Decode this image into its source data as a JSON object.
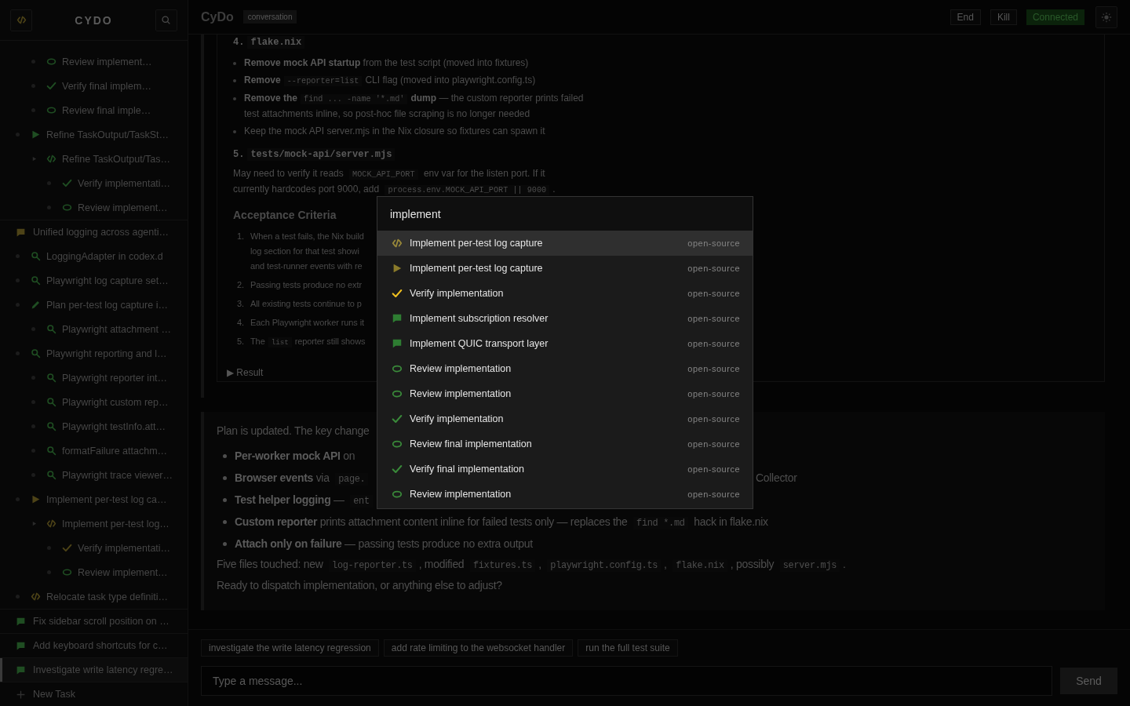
{
  "sidebar": {
    "title": "CYDO",
    "tasks": [
      {
        "children": [
          {
            "children": [
              {
                "label": "Review implement…",
                "kind": "eye",
                "color": "#1f4d22",
                "selected": false
              },
              {
                "label": "Verify final implem…",
                "kind": "check",
                "color": "#1f4d22",
                "selected": false
              },
              {
                "label": "Review final imple…",
                "kind": "eye",
                "color": "#1f4d22",
                "selected": false
              }
            ]
          },
          {
            "label": "Refine TaskOutput/TaskSt…",
            "kind": "play",
            "color": "#1f4d22",
            "selected": false,
            "children": [
              {
                "label": "Refine TaskOutput/Tas…",
                "kind": "code",
                "color": "#1f4d22",
                "selected": false,
                "toggle": true,
                "children": [
                  {
                    "label": "Verify implementati…",
                    "kind": "check",
                    "color": "#1f4d22",
                    "selected": false
                  },
                  {
                    "label": "Review implement…",
                    "kind": "eye",
                    "color": "#1f4d22",
                    "selected": false
                  }
                ]
              }
            ]
          }
        ]
      },
      {
        "label": "Unified logging across agenti…",
        "kind": "chat",
        "color": "#4d4317",
        "selected": false,
        "children": [
          {
            "label": "LoggingAdapter in codex.d",
            "kind": "search",
            "color": "#1f4d22",
            "selected": false
          },
          {
            "label": "Playwright log capture set…",
            "kind": "search",
            "color": "#1f4d22",
            "selected": false
          },
          {
            "label": "Plan per-test log capture i…",
            "kind": "pencil",
            "color": "#1f4d22",
            "selected": false,
            "children": [
              {
                "label": "Playwright attachment …",
                "kind": "search",
                "color": "#1f4d22",
                "selected": false
              }
            ]
          },
          {
            "label": "Playwright reporting and l…",
            "kind": "search",
            "color": "#1f4d22",
            "selected": false,
            "children": [
              {
                "label": "Playwright reporter int…",
                "kind": "search",
                "color": "#1f4d22",
                "selected": false
              },
              {
                "label": "Playwright custom rep…",
                "kind": "search",
                "color": "#1f4d22",
                "selected": false
              },
              {
                "label": "Playwright testInfo.att…",
                "kind": "search",
                "color": "#1f4d22",
                "selected": false
              },
              {
                "label": "formatFailure attachm…",
                "kind": "search",
                "color": "#1f4d22",
                "selected": false
              },
              {
                "label": "Playwright trace viewer…",
                "kind": "search",
                "color": "#1f4d22",
                "selected": false
              }
            ]
          },
          {
            "label": "Implement per-test log ca…",
            "kind": "play",
            "color": "#4d4317",
            "selected": false,
            "children": [
              {
                "label": "Implement per-test log…",
                "kind": "code",
                "color": "#4d4317",
                "selected": false,
                "toggle": true,
                "children": [
                  {
                    "label": "Verify implementati…",
                    "kind": "check",
                    "color": "#4d4317",
                    "selected": false
                  },
                  {
                    "label": "Review implement…",
                    "kind": "eye",
                    "color": "#1f4d22",
                    "selected": false
                  }
                ]
              }
            ]
          },
          {
            "label": "Relocate task type definiti…",
            "kind": "code",
            "color": "#4d4317",
            "selected": false
          }
        ]
      },
      {
        "label": "Fix sidebar scroll position on …",
        "kind": "chat",
        "color": "#1f4d22",
        "selected": false
      },
      {
        "label": "Add keyboard shortcuts for c…",
        "kind": "chat",
        "color": "#1f4d22",
        "selected": false
      },
      {
        "label": "Investigate write latency regre…",
        "kind": "chat",
        "color": "#1f4d22",
        "selected": true
      }
    ],
    "new_task": "New Task"
  },
  "header": {
    "title": "CyDo",
    "badge": "conversation",
    "buttons": [
      "End",
      "Kill"
    ],
    "status": "Connected"
  },
  "message_1": {
    "heading_4": [
      {
        "kind": "text",
        "t": "4."
      },
      {
        "kind": "code",
        "t": "flake.nix"
      }
    ],
    "bullets_4": [
      [
        {
          "kind": "bold",
          "t": "Remove mock API startup"
        },
        {
          "kind": "text",
          "t": " from the test script (moved into fixtures)"
        }
      ],
      [
        {
          "kind": "bold",
          "t": "Remove"
        },
        {
          "kind": "code",
          "t": "--reporter=list"
        },
        {
          "kind": "text",
          "t": "CLI flag (moved into playwright.config.ts)"
        }
      ],
      [
        {
          "kind": "bold",
          "t": "Remove the"
        },
        {
          "kind": "code",
          "t": "find ... -name '*.md'"
        },
        {
          "kind": "bold",
          "t": "dump"
        },
        {
          "kind": "text",
          "t": " — the custom reporter prints failed test attachments inline, so post-hoc file scraping is no longer needed"
        }
      ],
      [
        {
          "kind": "text",
          "t": "Keep the mock API server.mjs in the Nix closure so fixtures can spawn it"
        }
      ]
    ],
    "heading_5": [
      {
        "kind": "text",
        "t": "5."
      },
      {
        "kind": "code",
        "t": "tests/mock-api/server.mjs"
      }
    ],
    "paragraph": [
      {
        "kind": "text",
        "t": "May need to verify it reads "
      },
      {
        "kind": "code",
        "t": "MOCK_API_PORT"
      },
      {
        "kind": "text",
        "t": " env var for the listen port. If it currently hardcodes port 9000, add "
      },
      {
        "kind": "code",
        "t": "process.env.MOCK_API_PORT || 9000"
      },
      {
        "kind": "text",
        "t": "."
      }
    ],
    "criteria_title": "Acceptance Criteria",
    "criteria": [
      {
        "num": "1.",
        "lines": [
          [
            {
              "kind": "text",
              "t": "When a test fails, the Nix build"
            }
          ],
          [
            {
              "kind": "text",
              "t": "log section for that test showi"
            }
          ],
          [
            {
              "kind": "text",
              "t": "and test-runner events with re"
            }
          ]
        ]
      },
      {
        "num": "2.",
        "lines": [
          [
            {
              "kind": "text",
              "t": "Passing tests produce no extr"
            }
          ]
        ]
      },
      {
        "num": "3.",
        "lines": [
          [
            {
              "kind": "text",
              "t": "All existing tests continue to p"
            }
          ]
        ]
      },
      {
        "num": "4.",
        "lines": [
          [
            {
              "kind": "text",
              "t": "Each Playwright worker runs it"
            }
          ]
        ]
      },
      {
        "num": "5.",
        "lines": [
          [
            {
              "kind": "text",
              "t": "The"
            },
            {
              "kind": "code",
              "t": "list"
            },
            {
              "kind": "text",
              "t": "reporter still shows"
            }
          ]
        ]
      }
    ],
    "result": {
      "marker": "▶",
      "label": "Result"
    }
  },
  "message_2": {
    "intro": "Plan is updated. The key change",
    "bullets": [
      {
        "parts": [
          {
            "kind": "bold",
            "t": "Per-worker mock API"
          },
          {
            "kind": "text",
            "t": " on"
          }
        ]
      },
      {
        "parts": [
          {
            "kind": "bold",
            "t": "Browser events"
          },
          {
            "kind": "text",
            "t": " via "
          },
          {
            "kind": "code",
            "t": "page."
          }
        ],
        "right": "Collector"
      },
      {
        "parts": [
          {
            "kind": "bold",
            "t": "Test helper logging"
          },
          {
            "kind": "text",
            "t": " — "
          },
          {
            "kind": "code",
            "t": "ent"
          }
        ]
      },
      {
        "parts": [
          {
            "kind": "bold",
            "t": "Custom reporter"
          },
          {
            "kind": "text",
            "t": " prints attachment content inline for failed tests only — replaces the "
          },
          {
            "kind": "code",
            "t": "find *.md"
          },
          {
            "kind": "text",
            "t": " hack in flake.nix"
          }
        ]
      },
      {
        "parts": [
          {
            "kind": "bold",
            "t": "Attach only on failure"
          },
          {
            "kind": "text",
            "t": " — passing tests produce no extra output"
          }
        ]
      }
    ],
    "summary": [
      {
        "kind": "text",
        "t": "Five files touched: new "
      },
      {
        "kind": "code",
        "t": "log-reporter.ts"
      },
      {
        "kind": "text",
        "t": ", modified "
      },
      {
        "kind": "code",
        "t": "fixtures.ts"
      },
      {
        "kind": "text",
        "t": ", "
      },
      {
        "kind": "code",
        "t": "playwright.config.ts"
      },
      {
        "kind": "text",
        "t": ", "
      },
      {
        "kind": "code",
        "t": "flake.nix"
      },
      {
        "kind": "text",
        "t": ", possibly "
      },
      {
        "kind": "code",
        "t": "server.mjs"
      },
      {
        "kind": "text",
        "t": "."
      }
    ],
    "closing": "Ready to dispatch implementation, or anything else to adjust?"
  },
  "suggestions": [
    "investigate the write latency regression",
    "add rate limiting to the websocket handler",
    "run the full test suite"
  ],
  "composer": {
    "placeholder": "Type a message...",
    "send": "Send"
  },
  "palette": {
    "query": "implement",
    "items": [
      {
        "kind": "code",
        "color": "#9a8a3a",
        "label": "Implement per-test log capture",
        "tag": "open-source",
        "selected": true
      },
      {
        "kind": "play",
        "color": "#8a7a2a",
        "label": "Implement per-test log capture",
        "tag": "open-source",
        "selected": false
      },
      {
        "kind": "check",
        "color": "#f0c020",
        "label": "Verify implementation",
        "tag": "open-source",
        "selected": false
      },
      {
        "kind": "chat",
        "color": "#2e7d32",
        "label": "Implement subscription resolver",
        "tag": "open-source",
        "selected": false
      },
      {
        "kind": "chat",
        "color": "#2e7d32",
        "label": "Implement QUIC transport layer",
        "tag": "open-source",
        "selected": false
      },
      {
        "kind": "eye",
        "color": "#3a8a3a",
        "label": "Review implementation",
        "tag": "open-source",
        "selected": false
      },
      {
        "kind": "eye",
        "color": "#3a8a3a",
        "label": "Review implementation",
        "tag": "open-source",
        "selected": false
      },
      {
        "kind": "check",
        "color": "#3a8a3a",
        "label": "Verify implementation",
        "tag": "open-source",
        "selected": false
      },
      {
        "kind": "eye",
        "color": "#3a8a3a",
        "label": "Review final implementation",
        "tag": "open-source",
        "selected": false
      },
      {
        "kind": "check",
        "color": "#3a8a3a",
        "label": "Verify final implementation",
        "tag": "open-source",
        "selected": false
      },
      {
        "kind": "eye",
        "color": "#3a8a3a",
        "label": "Review implementation",
        "tag": "open-source",
        "selected": false
      }
    ]
  }
}
